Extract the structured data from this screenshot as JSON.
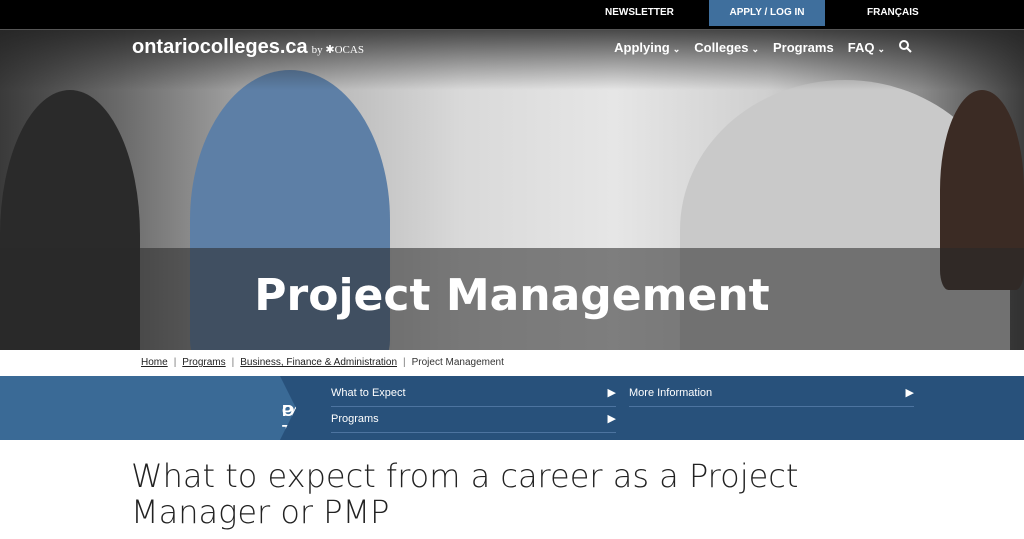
{
  "topbar": {
    "newsletter": "NEWSLETTER",
    "apply": "APPLY / LOG IN",
    "language": "FRANÇAIS"
  },
  "header": {
    "logo": "ontariocolleges.ca",
    "logo_by": "by ✱OCAS",
    "nav": [
      {
        "label": "Applying",
        "dropdown": true
      },
      {
        "label": "Colleges",
        "dropdown": true
      },
      {
        "label": "Programs",
        "dropdown": false
      },
      {
        "label": "FAQ",
        "dropdown": true
      }
    ],
    "search_icon": "search-icon"
  },
  "hero": {
    "title": "Project Management"
  },
  "breadcrumb": [
    "Home",
    "Programs",
    "Business, Finance & Administration",
    "Project Management"
  ],
  "on_this_page": {
    "label_line1": "ON THIS",
    "label_line2": "PAGE",
    "links": [
      "What to Expect",
      "Programs",
      "More Information"
    ]
  },
  "main": {
    "heading": "What to expect from a career as a Project Manager or PMP"
  },
  "colors": {
    "apply_bg": "#3f6f9d",
    "nav_band": "#28517b",
    "label_bg": "#3a6a96"
  }
}
